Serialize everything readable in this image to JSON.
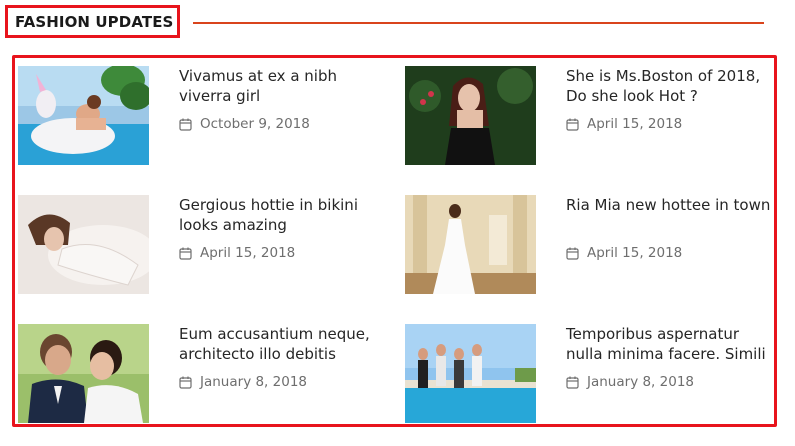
{
  "section": {
    "title": "FASHION UPDATES"
  },
  "posts": [
    {
      "title": "Vivamus at ex a nibh viverra girl",
      "date": "October 9, 2018",
      "icon": "calendar-icon",
      "image": "woman-on-unicorn-float-in-pool"
    },
    {
      "title": "She is Ms.Boston of 2018, Do she look Hot ?",
      "date": "April 15, 2018",
      "icon": "calendar-icon",
      "image": "woman-in-black-dress-garden"
    },
    {
      "title": "Gergious hottie in bikini looks amazing",
      "date": "April 15, 2018",
      "icon": "calendar-icon",
      "image": "woman-lying-in-lace-dress"
    },
    {
      "title": "Ria Mia new hottee in town",
      "date": "April 15, 2018",
      "icon": "calendar-icon",
      "image": "bride-in-white-gown-hall"
    },
    {
      "title": "Eum accusantium neque, architecto illo debitis",
      "date": "January 8, 2018",
      "icon": "calendar-icon",
      "image": "wedding-couple-embrace"
    },
    {
      "title": "Temporibus aspernatur nulla minima facere. Simili",
      "date": "January 8, 2018",
      "icon": "calendar-icon",
      "image": "group-in-swimsuits-by-pool"
    }
  ],
  "colors": {
    "accent": "#e8141c",
    "rule": "#d9441c",
    "date_text": "#6e6e6e"
  }
}
